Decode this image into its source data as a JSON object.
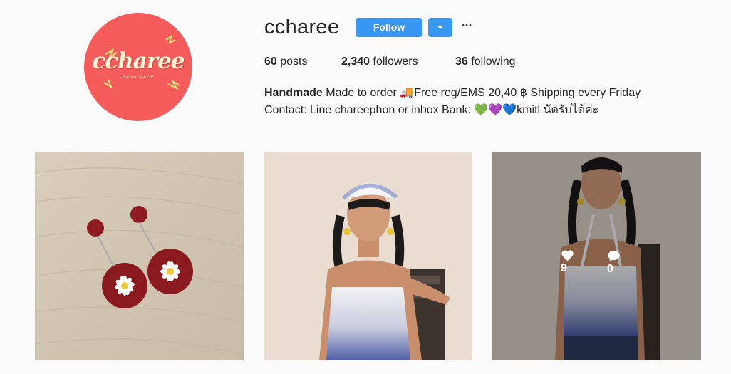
{
  "profile": {
    "username": "ccharee",
    "avatar": {
      "logo_text": "ccharee",
      "logo_subtext": "HAND MADE",
      "background_color": "#f45c5c"
    },
    "follow_label": "Follow",
    "dropdown_icon": "caret-down-icon",
    "more_label": "···",
    "stats": {
      "posts_count": "60",
      "posts_label": "posts",
      "followers_count": "2,340",
      "followers_label": "followers",
      "following_count": "36",
      "following_label": "following"
    },
    "bio": {
      "name": "Handmade",
      "line1_rest": " Made to order 🚚Free reg/EMS 20,40 ฿ Shipping every Friday",
      "line2": "Contact: Line chareephon or inbox Bank: 💚💜💙kmitl นัดรับได้ค่ะ"
    }
  },
  "posts": [
    {
      "image": "red-flower-earrings-photo"
    },
    {
      "image": "girl-bandana-tie-dye-top-photo"
    },
    {
      "image": "girl-tie-dye-halter-top-photo",
      "hover": {
        "likes": "9",
        "comments": "0",
        "like_icon": "heart-icon",
        "comment_icon": "comment-icon"
      }
    }
  ],
  "colors": {
    "accent": "#3897f0",
    "background": "#fafafa",
    "text": "#262626"
  }
}
